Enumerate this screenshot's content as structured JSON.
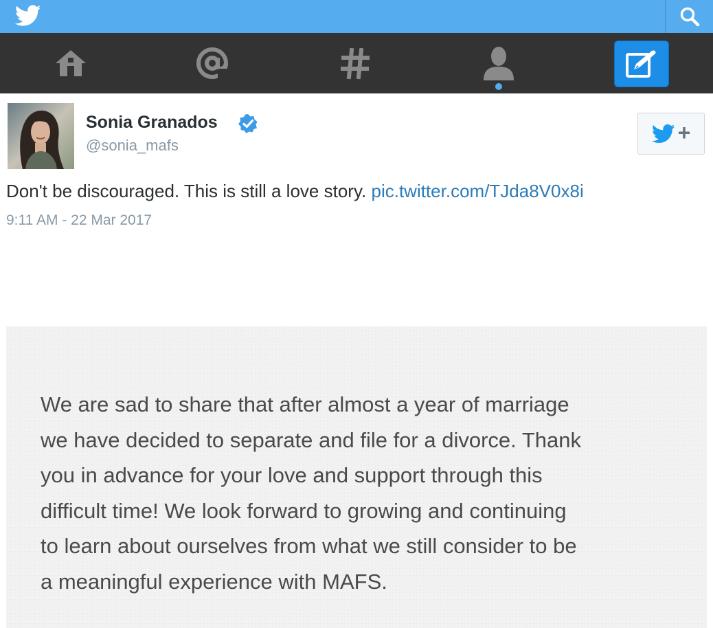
{
  "topbar": {
    "logo_icon": "twitter-bird-icon",
    "search_icon": "search-icon",
    "color": "#55acee"
  },
  "navbar": {
    "items": [
      {
        "icon": "home-icon"
      },
      {
        "icon": "mentions-icon"
      },
      {
        "icon": "hashtag-icon"
      },
      {
        "icon": "profile-icon",
        "active": true
      },
      {
        "icon": "compose-icon"
      }
    ]
  },
  "tweet": {
    "user": {
      "name": "Sonia Granados",
      "handle": "@sonia_mafs",
      "verified": true
    },
    "text": "Don't be discouraged. This is still a love story.",
    "link": "pic.twitter.com/TJda8V0x8i",
    "timestamp": "9:11 AM - 22 Mar 2017",
    "follow_icon": "follow-bird-plus-icon"
  },
  "attachment": {
    "text": "We are sad to share that after almost a year of marriage\nwe have decided to separate and file for a divorce. Thank\nyou in advance for your love and support through this\ndifficult time! We look forward to growing and continuing\nto learn about ourselves from what we still consider to be\na meaningful experience with MAFS."
  },
  "colors": {
    "link": "#2b7bb9",
    "muted": "#8899a6",
    "nav_background": "#333333",
    "compose_active": "#1d8ee8"
  }
}
